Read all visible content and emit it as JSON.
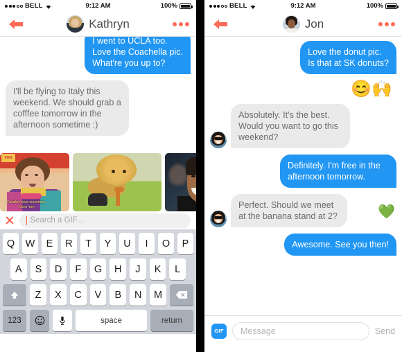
{
  "status_bar": {
    "carrier": "BELL",
    "time": "9:12 AM",
    "battery": "100%",
    "signal_dots_filled": 3,
    "signal_dots_empty": 2,
    "wifi_icon": "wifi-icon"
  },
  "left_phone": {
    "nav": {
      "back_icon": "back-arrow-icon",
      "avatar": "kathryn-avatar",
      "name": "Kathryn",
      "more_icon": "more-options-icon"
    },
    "messages": [
      {
        "side": "out",
        "text": "I went to UCLA too.\nLove the Coachella pic.\nWhat're you up to?",
        "clipped": true
      },
      {
        "side": "in",
        "text": "I'll be flying to Italy this weekend. We should grab a cofffee tomorrow in the afternoon sometime :)"
      }
    ],
    "gif_picker": {
      "gifs": [
        {
          "name": "gif-thumb-woman-sweater",
          "caption": "Freakin' love surprises.\nI love 'em"
        },
        {
          "name": "gif-thumb-lion-puppet",
          "caption": ""
        },
        {
          "name": "gif-thumb-man-smiling",
          "caption": ""
        }
      ],
      "close_icon": "close-x-icon",
      "search_placeholder": "Search a GIF...",
      "search_value": ""
    },
    "keyboard": {
      "row1": [
        "Q",
        "W",
        "E",
        "R",
        "T",
        "Y",
        "U",
        "I",
        "O",
        "P"
      ],
      "row2": [
        "A",
        "S",
        "D",
        "F",
        "G",
        "H",
        "J",
        "K",
        "L"
      ],
      "row3": [
        "Z",
        "X",
        "C",
        "V",
        "B",
        "N",
        "M"
      ],
      "shift_icon": "shift-arrow-icon",
      "backspace_icon": "backspace-icon",
      "numbers_label": "123",
      "emoji_icon": "emoji-smiley-icon",
      "mic_icon": "microphone-icon",
      "space_label": "space",
      "return_label": "return"
    }
  },
  "right_phone": {
    "nav": {
      "back_icon": "back-arrow-icon",
      "avatar": "jon-avatar",
      "name": "Jon",
      "more_icon": "more-options-icon"
    },
    "messages": [
      {
        "side": "out",
        "text": "Love the donut pic.\nIs that at SK donuts?"
      },
      {
        "side": "emoji",
        "text": "😊🙌"
      },
      {
        "side": "in",
        "avatar": true,
        "text": "Absolutely. It's the best. Would you want to go this weekend?"
      },
      {
        "side": "out",
        "text": "Definitely. I'm free in the afternoon tomorrow."
      },
      {
        "side": "in",
        "avatar": true,
        "text": "Perfect. Should we meet at the banana stand at 2?",
        "heart": "💚"
      },
      {
        "side": "out",
        "text": "Awesome. See you then!"
      }
    ],
    "message_bar": {
      "gif_label": "GIF",
      "placeholder": "Message",
      "value": "",
      "send_label": "Send"
    }
  },
  "colors": {
    "outgoing_bubble": "#2196f3",
    "incoming_bubble": "#eaeaea",
    "accent_coral": "#fd6a56",
    "keyboard_bg": "#d2d6dc",
    "heart_green": "#4cd07d"
  }
}
